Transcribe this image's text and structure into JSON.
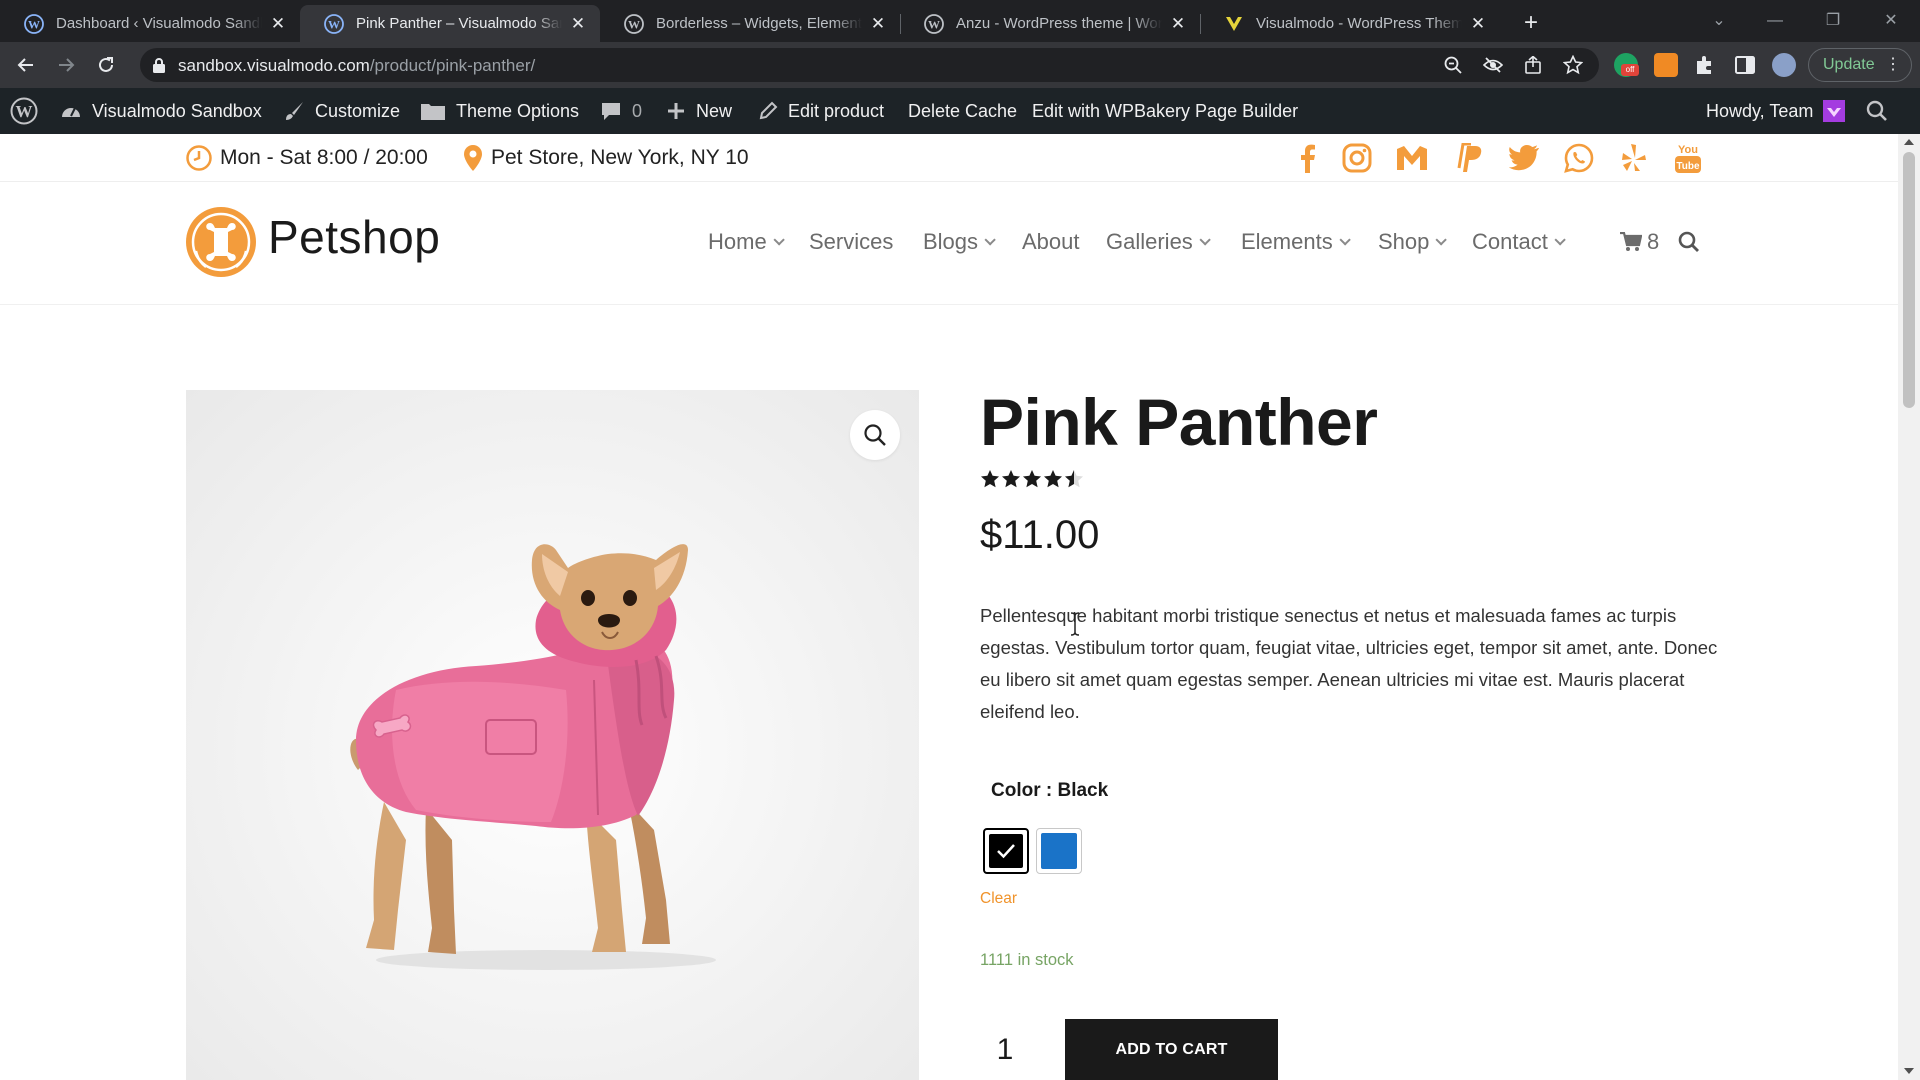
{
  "browser": {
    "tabs": [
      {
        "title": "Dashboard ‹ Visualmodo Sandbox"
      },
      {
        "title": "Pink Panther – Visualmodo Sandbox"
      },
      {
        "title": "Borderless – Widgets, Elements, Templates"
      },
      {
        "title": "Anzu - WordPress theme | WordPress"
      },
      {
        "title": "Visualmodo - WordPress Themes"
      }
    ],
    "url_domain": "sandbox.visualmodo.com",
    "url_path": "/product/pink-panther/",
    "update_label": "Update",
    "colors": {
      "frame": "#202124",
      "toolbar": "#35363a",
      "update_text": "#81c995"
    }
  },
  "adminbar": {
    "site_name": "Visualmodo Sandbox",
    "customize": "Customize",
    "theme_options": "Theme Options",
    "comments_count": "0",
    "new_label": "New",
    "edit_product": "Edit product",
    "delete_cache": "Delete Cache",
    "edit_wpbakery": "Edit with WPBakery Page Builder",
    "howdy": "Howdy, Team",
    "color": "#1d2327"
  },
  "topbar": {
    "hours": "Mon - Sat 8:00 / 20:00",
    "address": "Pet Store, New York, NY 10",
    "social_icons": [
      "facebook-icon",
      "instagram-icon",
      "gmail-icon",
      "paypal-icon",
      "twitter-icon",
      "whatsapp-icon",
      "yelp-icon",
      "youtube-icon"
    ],
    "accent": "#f39c3c"
  },
  "header": {
    "logo_text": "Petshop",
    "menu": [
      {
        "label": "Home",
        "has_dropdown": true
      },
      {
        "label": "Services",
        "has_dropdown": false
      },
      {
        "label": "Blogs",
        "has_dropdown": true
      },
      {
        "label": "About",
        "has_dropdown": false
      },
      {
        "label": "Galleries",
        "has_dropdown": true
      },
      {
        "label": "Elements",
        "has_dropdown": true
      },
      {
        "label": "Shop",
        "has_dropdown": true
      },
      {
        "label": "Contact",
        "has_dropdown": true
      }
    ],
    "cart_count": "8"
  },
  "product": {
    "title": "Pink Panther",
    "rating": 4.5,
    "rating_max": 5,
    "price": "$11.00",
    "description": "Pellentesque habitant morbi tristique senectus et netus et malesuada fames ac turpis egestas. Vestibulum tortor quam, feugiat vitae, ultricies eget, tempor sit amet, ante. Donec eu libero sit amet quam egestas semper. Aenean ultricies mi vitae est. Mauris placerat eleifend leo.",
    "color_label": "Color : Black",
    "swatches": [
      {
        "name": "Black",
        "color": "#000000",
        "selected": true
      },
      {
        "name": "Blue",
        "color": "#1a73c8",
        "selected": false
      }
    ],
    "clear_label": "Clear",
    "stock": "1111 in stock",
    "quantity": "1",
    "add_to_cart": "ADD TO CART"
  }
}
